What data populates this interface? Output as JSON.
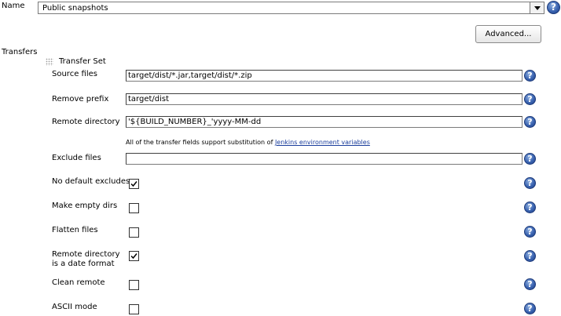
{
  "name_row": {
    "label": "Name",
    "selected_value": "Public snapshots",
    "help_icon": "help-icon"
  },
  "advanced_button": {
    "label": "Advanced..."
  },
  "transfers": {
    "label": "Transfers",
    "transfer_set_label": "Transfer Set",
    "fields": {
      "source_files": {
        "label": "Source files",
        "value": "target/dist/*.jar,target/dist/*.zip"
      },
      "remove_prefix": {
        "label": "Remove prefix",
        "value": "target/dist"
      },
      "remote_directory": {
        "label": "Remote directory",
        "value": "'${BUILD_NUMBER}_'yyyy-MM-dd"
      },
      "exclude_files": {
        "label": "Exclude files",
        "value": ""
      }
    },
    "note_text": "All of the transfer fields support substitution of ",
    "note_link": "Jenkins environment variables",
    "checkboxes": {
      "no_default_excludes": {
        "label": "No default excludes",
        "checked": true
      },
      "make_empty_dirs": {
        "label": "Make empty dirs",
        "checked": false
      },
      "flatten_files": {
        "label": "Flatten files",
        "checked": false
      },
      "remote_dir_date": {
        "label_line1": "Remote directory",
        "label_line2": "is a date format",
        "checked": true
      },
      "clean_remote": {
        "label": "Clean remote",
        "checked": false
      },
      "ascii_mode": {
        "label": "ASCII mode",
        "checked": false
      }
    }
  },
  "colors": {
    "link": "#1a3d9c",
    "help_icon": "#3a63b0"
  }
}
